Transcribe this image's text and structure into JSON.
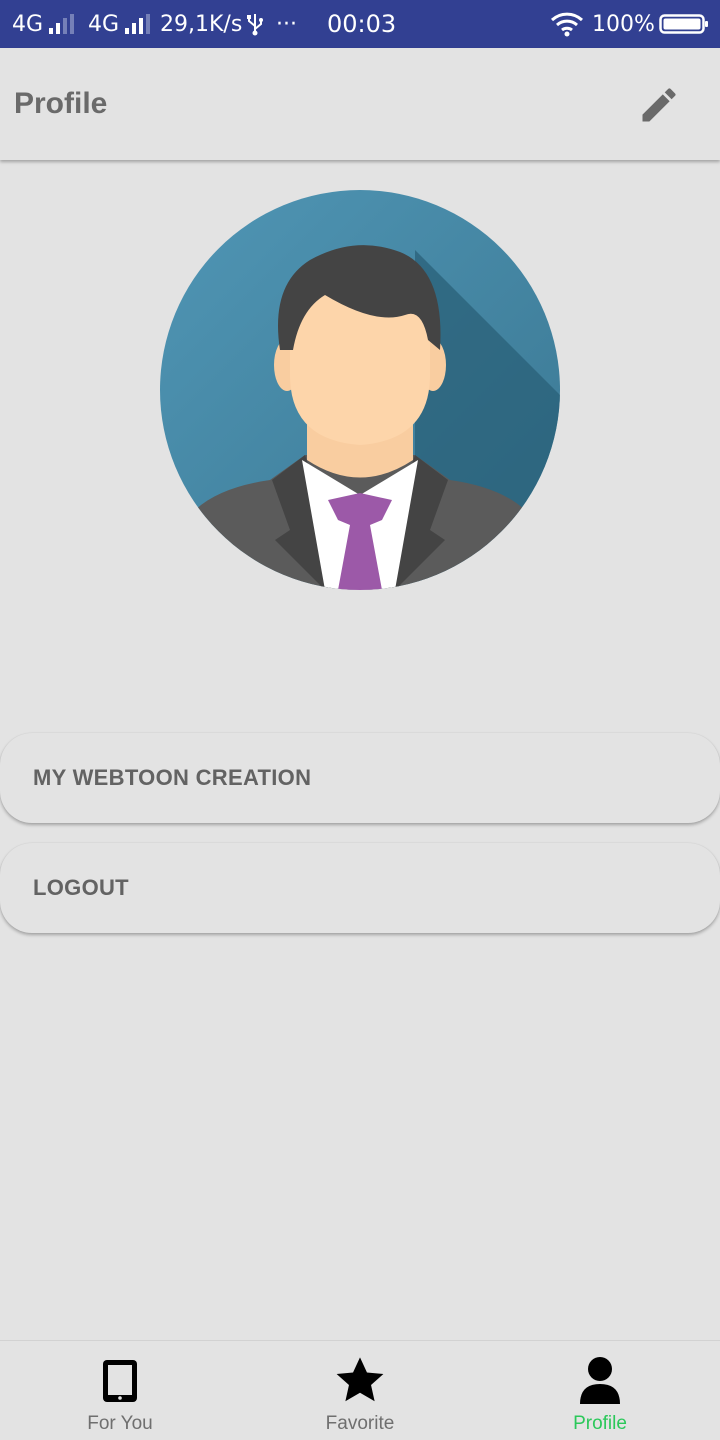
{
  "status_bar": {
    "network1": "4G",
    "network2": "4G",
    "speed": "29,1K/s",
    "usb_icon": "usb-icon",
    "more": "···",
    "time": "00:03",
    "battery": "100%"
  },
  "app_bar": {
    "title": "Profile",
    "edit_icon": "pencil-icon"
  },
  "profile": {
    "avatar_icon": "businessman-avatar"
  },
  "menu": {
    "creation_label": "MY WEBTOON CREATION",
    "logout_label": "LOGOUT"
  },
  "bottom_nav": {
    "items": [
      {
        "label": "For You",
        "icon": "tablet-icon",
        "active": false
      },
      {
        "label": "Favorite",
        "icon": "star-icon",
        "active": false
      },
      {
        "label": "Profile",
        "icon": "person-icon",
        "active": true
      }
    ]
  },
  "colors": {
    "status_bar_bg": "#324092",
    "background": "#e3e3e3",
    "active_tab": "#2bc85a",
    "avatar_bg": "#4a8cac",
    "tie": "#9c59a8"
  }
}
